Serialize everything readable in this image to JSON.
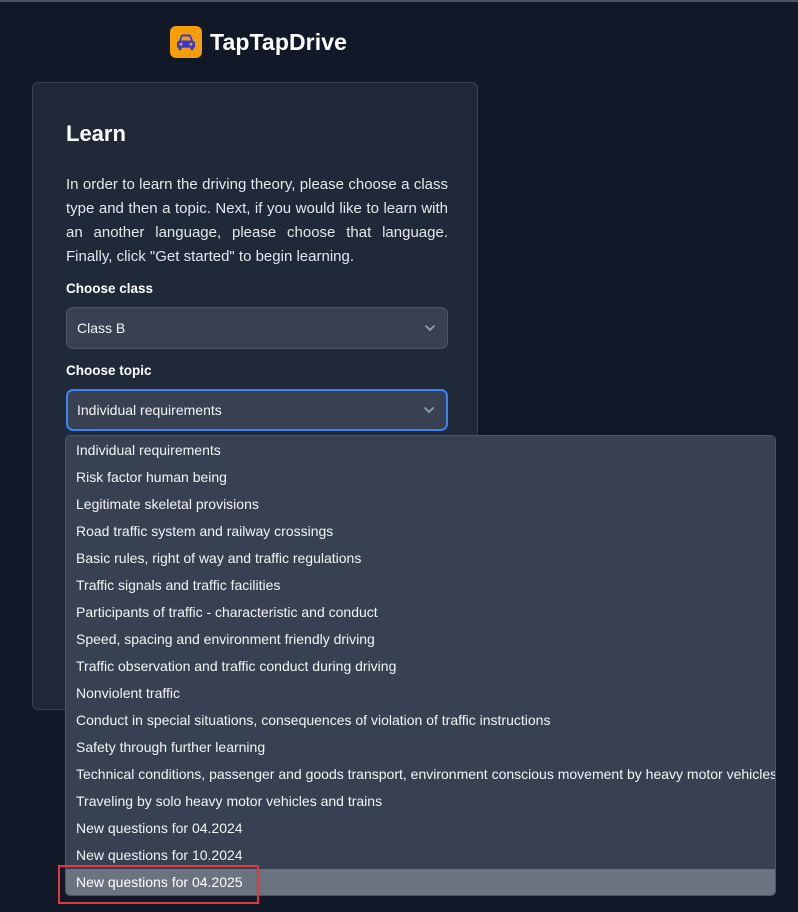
{
  "app": {
    "name": "TapTapDrive",
    "logo_icon": "car-icon",
    "accent_color": "#f59e0b"
  },
  "learn": {
    "title": "Learn",
    "description": "In order to learn the driving theory, please choose a class type and then a topic. Next, if you would like to learn with an another language, please choose that language. Finally, click \"Get started\" to begin learning.",
    "class_label": "Choose class",
    "class_value": "Class B",
    "topic_label": "Choose topic",
    "topic_value": "Individual requirements"
  },
  "topic_options": [
    "Individual requirements",
    "Risk factor human being",
    "Legitimate skeletal provisions",
    "Road traffic system and railway crossings",
    "Basic rules, right of way and traffic regulations",
    "Traffic signals and traffic facilities",
    "Participants of traffic - characteristic and conduct",
    "Speed, spacing and environment friendly driving",
    "Traffic observation and traffic conduct during driving",
    "Nonviolent traffic",
    "Conduct in special situations, consequences of violation of traffic instructions",
    "Safety through further learning",
    "Technical conditions, passenger and goods transport, environment conscious movement by heavy motor vehicles",
    "Traveling by solo heavy motor vehicles and trains",
    "New questions for 04.2024",
    "New questions for 10.2024",
    "New questions for 04.2025"
  ],
  "highlighted_option": "New questions for 04.2025",
  "colors": {
    "background": "#111827",
    "card": "#1f2937",
    "focus_ring": "#3b82f6",
    "highlight_box": "#e0393e"
  }
}
